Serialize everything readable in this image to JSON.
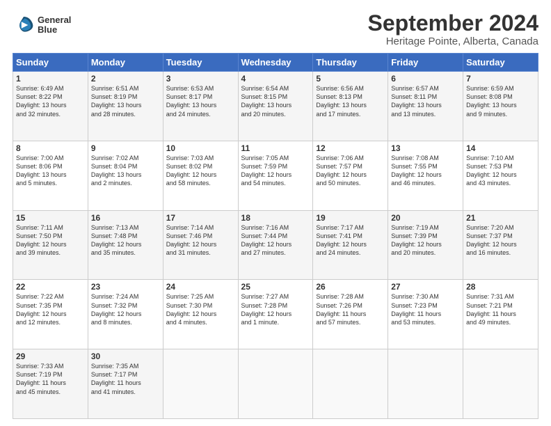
{
  "logo": {
    "line1": "General",
    "line2": "Blue"
  },
  "title": "September 2024",
  "subtitle": "Heritage Pointe, Alberta, Canada",
  "weekdays": [
    "Sunday",
    "Monday",
    "Tuesday",
    "Wednesday",
    "Thursday",
    "Friday",
    "Saturday"
  ],
  "weeks": [
    [
      {
        "day": "1",
        "info": "Sunrise: 6:49 AM\nSunset: 8:22 PM\nDaylight: 13 hours\nand 32 minutes."
      },
      {
        "day": "2",
        "info": "Sunrise: 6:51 AM\nSunset: 8:19 PM\nDaylight: 13 hours\nand 28 minutes."
      },
      {
        "day": "3",
        "info": "Sunrise: 6:53 AM\nSunset: 8:17 PM\nDaylight: 13 hours\nand 24 minutes."
      },
      {
        "day": "4",
        "info": "Sunrise: 6:54 AM\nSunset: 8:15 PM\nDaylight: 13 hours\nand 20 minutes."
      },
      {
        "day": "5",
        "info": "Sunrise: 6:56 AM\nSunset: 8:13 PM\nDaylight: 13 hours\nand 17 minutes."
      },
      {
        "day": "6",
        "info": "Sunrise: 6:57 AM\nSunset: 8:11 PM\nDaylight: 13 hours\nand 13 minutes."
      },
      {
        "day": "7",
        "info": "Sunrise: 6:59 AM\nSunset: 8:08 PM\nDaylight: 13 hours\nand 9 minutes."
      }
    ],
    [
      {
        "day": "8",
        "info": "Sunrise: 7:00 AM\nSunset: 8:06 PM\nDaylight: 13 hours\nand 5 minutes."
      },
      {
        "day": "9",
        "info": "Sunrise: 7:02 AM\nSunset: 8:04 PM\nDaylight: 13 hours\nand 2 minutes."
      },
      {
        "day": "10",
        "info": "Sunrise: 7:03 AM\nSunset: 8:02 PM\nDaylight: 12 hours\nand 58 minutes."
      },
      {
        "day": "11",
        "info": "Sunrise: 7:05 AM\nSunset: 7:59 PM\nDaylight: 12 hours\nand 54 minutes."
      },
      {
        "day": "12",
        "info": "Sunrise: 7:06 AM\nSunset: 7:57 PM\nDaylight: 12 hours\nand 50 minutes."
      },
      {
        "day": "13",
        "info": "Sunrise: 7:08 AM\nSunset: 7:55 PM\nDaylight: 12 hours\nand 46 minutes."
      },
      {
        "day": "14",
        "info": "Sunrise: 7:10 AM\nSunset: 7:53 PM\nDaylight: 12 hours\nand 43 minutes."
      }
    ],
    [
      {
        "day": "15",
        "info": "Sunrise: 7:11 AM\nSunset: 7:50 PM\nDaylight: 12 hours\nand 39 minutes."
      },
      {
        "day": "16",
        "info": "Sunrise: 7:13 AM\nSunset: 7:48 PM\nDaylight: 12 hours\nand 35 minutes."
      },
      {
        "day": "17",
        "info": "Sunrise: 7:14 AM\nSunset: 7:46 PM\nDaylight: 12 hours\nand 31 minutes."
      },
      {
        "day": "18",
        "info": "Sunrise: 7:16 AM\nSunset: 7:44 PM\nDaylight: 12 hours\nand 27 minutes."
      },
      {
        "day": "19",
        "info": "Sunrise: 7:17 AM\nSunset: 7:41 PM\nDaylight: 12 hours\nand 24 minutes."
      },
      {
        "day": "20",
        "info": "Sunrise: 7:19 AM\nSunset: 7:39 PM\nDaylight: 12 hours\nand 20 minutes."
      },
      {
        "day": "21",
        "info": "Sunrise: 7:20 AM\nSunset: 7:37 PM\nDaylight: 12 hours\nand 16 minutes."
      }
    ],
    [
      {
        "day": "22",
        "info": "Sunrise: 7:22 AM\nSunset: 7:35 PM\nDaylight: 12 hours\nand 12 minutes."
      },
      {
        "day": "23",
        "info": "Sunrise: 7:24 AM\nSunset: 7:32 PM\nDaylight: 12 hours\nand 8 minutes."
      },
      {
        "day": "24",
        "info": "Sunrise: 7:25 AM\nSunset: 7:30 PM\nDaylight: 12 hours\nand 4 minutes."
      },
      {
        "day": "25",
        "info": "Sunrise: 7:27 AM\nSunset: 7:28 PM\nDaylight: 12 hours\nand 1 minute."
      },
      {
        "day": "26",
        "info": "Sunrise: 7:28 AM\nSunset: 7:26 PM\nDaylight: 11 hours\nand 57 minutes."
      },
      {
        "day": "27",
        "info": "Sunrise: 7:30 AM\nSunset: 7:23 PM\nDaylight: 11 hours\nand 53 minutes."
      },
      {
        "day": "28",
        "info": "Sunrise: 7:31 AM\nSunset: 7:21 PM\nDaylight: 11 hours\nand 49 minutes."
      }
    ],
    [
      {
        "day": "29",
        "info": "Sunrise: 7:33 AM\nSunset: 7:19 PM\nDaylight: 11 hours\nand 45 minutes."
      },
      {
        "day": "30",
        "info": "Sunrise: 7:35 AM\nSunset: 7:17 PM\nDaylight: 11 hours\nand 41 minutes."
      },
      {
        "day": "",
        "info": ""
      },
      {
        "day": "",
        "info": ""
      },
      {
        "day": "",
        "info": ""
      },
      {
        "day": "",
        "info": ""
      },
      {
        "day": "",
        "info": ""
      }
    ]
  ]
}
